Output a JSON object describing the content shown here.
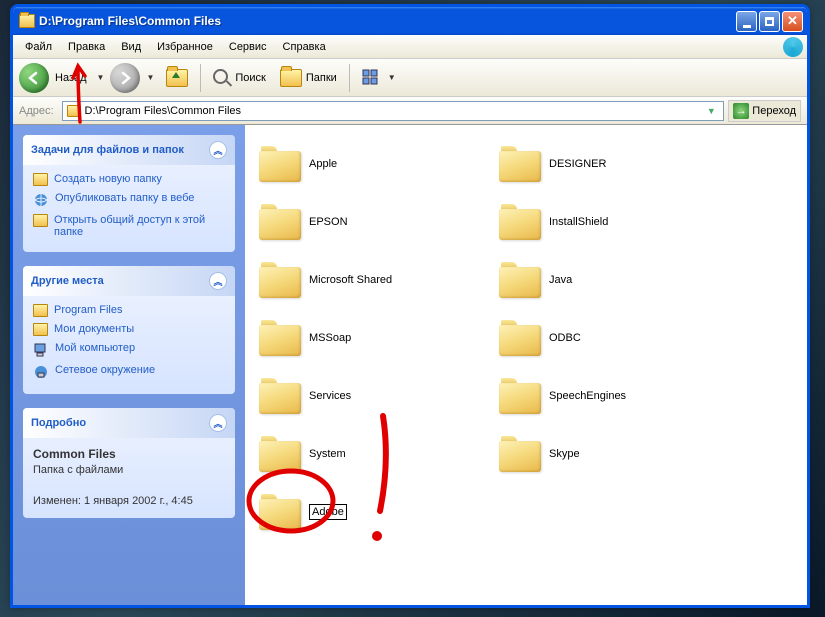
{
  "window": {
    "title": "D:\\Program Files\\Common Files"
  },
  "menu": {
    "file": "Файл",
    "edit": "Правка",
    "view": "Вид",
    "favorites": "Избранное",
    "service": "Сервис",
    "help": "Справка"
  },
  "toolbar": {
    "back": "Назад",
    "search": "Поиск",
    "folders": "Папки"
  },
  "address": {
    "label": "Адрес:",
    "value": "D:\\Program Files\\Common Files",
    "go": "Переход"
  },
  "tasks": {
    "header": "Задачи для файлов и папок",
    "items": [
      {
        "label": "Создать новую папку",
        "icon": "new-folder"
      },
      {
        "label": "Опубликовать папку в вебе",
        "icon": "publish-web"
      },
      {
        "label": "Открыть общий доступ к этой папке",
        "icon": "share"
      }
    ]
  },
  "places": {
    "header": "Другие места",
    "items": [
      {
        "label": "Program Files",
        "icon": "folder"
      },
      {
        "label": "Мои документы",
        "icon": "my-documents"
      },
      {
        "label": "Мой компьютер",
        "icon": "my-computer"
      },
      {
        "label": "Сетевое окружение",
        "icon": "network"
      }
    ]
  },
  "details": {
    "header": "Подробно",
    "name": "Common Files",
    "type": "Папка с файлами",
    "modified_label": "Изменен:",
    "modified": "1 января 2002 г., 4:45"
  },
  "folders": [
    {
      "name": "Apple"
    },
    {
      "name": "DESIGNER"
    },
    {
      "name": "EPSON"
    },
    {
      "name": "InstallShield"
    },
    {
      "name": "Microsoft Shared"
    },
    {
      "name": "Java"
    },
    {
      "name": "MSSoap"
    },
    {
      "name": "ODBC"
    },
    {
      "name": "Services"
    },
    {
      "name": "SpeechEngines"
    },
    {
      "name": "System"
    },
    {
      "name": "Skype"
    },
    {
      "name": "Adobe",
      "renaming": true
    }
  ]
}
